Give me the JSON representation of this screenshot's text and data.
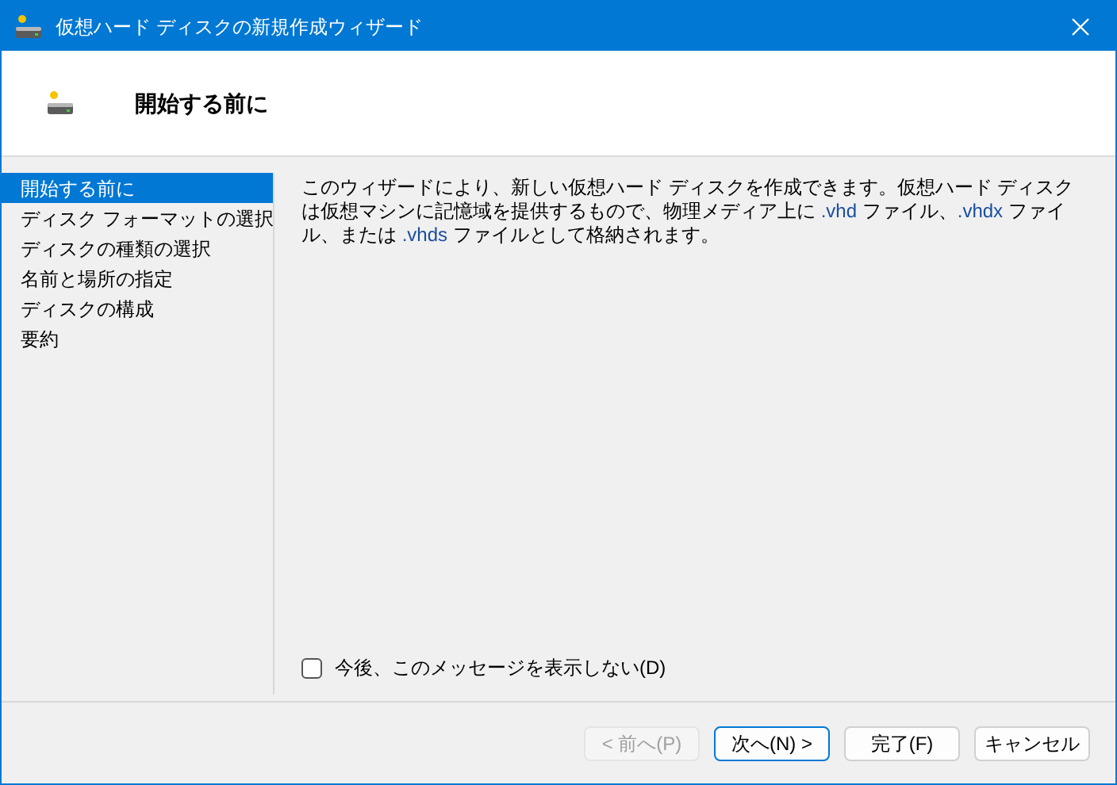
{
  "window": {
    "title": "仮想ハード ディスクの新規作成ウィザード"
  },
  "header": {
    "title": "開始する前に"
  },
  "steps": [
    {
      "label": "開始する前に",
      "selected": true
    },
    {
      "label": "ディスク フォーマットの選択",
      "selected": false
    },
    {
      "label": "ディスクの種類の選択",
      "selected": false
    },
    {
      "label": "名前と場所の指定",
      "selected": false
    },
    {
      "label": "ディスクの構成",
      "selected": false
    },
    {
      "label": "要約",
      "selected": false
    }
  ],
  "description": [
    {
      "kind": "plain",
      "text": "このウィザードにより、新しい仮想ハード ディスクを作成できます。仮想ハード ディスクは仮想マシンに記憶域を提供するもので、物理メディア上に "
    },
    {
      "kind": "ext",
      "text": ".vhd"
    },
    {
      "kind": "plain",
      "text": " ファイル、"
    },
    {
      "kind": "ext",
      "text": ".vhdx"
    },
    {
      "kind": "plain",
      "text": " ファイル、または "
    },
    {
      "kind": "ext",
      "text": ".vhds"
    },
    {
      "kind": "plain",
      "text": " ファイルとして格納されます。"
    }
  ],
  "dont_show_again": {
    "label": "今後、このメッセージを表示しない(D)",
    "checked": false
  },
  "buttons": [
    {
      "label": "< 前へ(P)",
      "disabled": true,
      "default": false
    },
    {
      "label": "次へ(N) >",
      "disabled": false,
      "default": true
    },
    {
      "label": "完了(F)",
      "disabled": false,
      "default": false
    },
    {
      "label": "キャンセル",
      "disabled": false,
      "default": false
    }
  ]
}
